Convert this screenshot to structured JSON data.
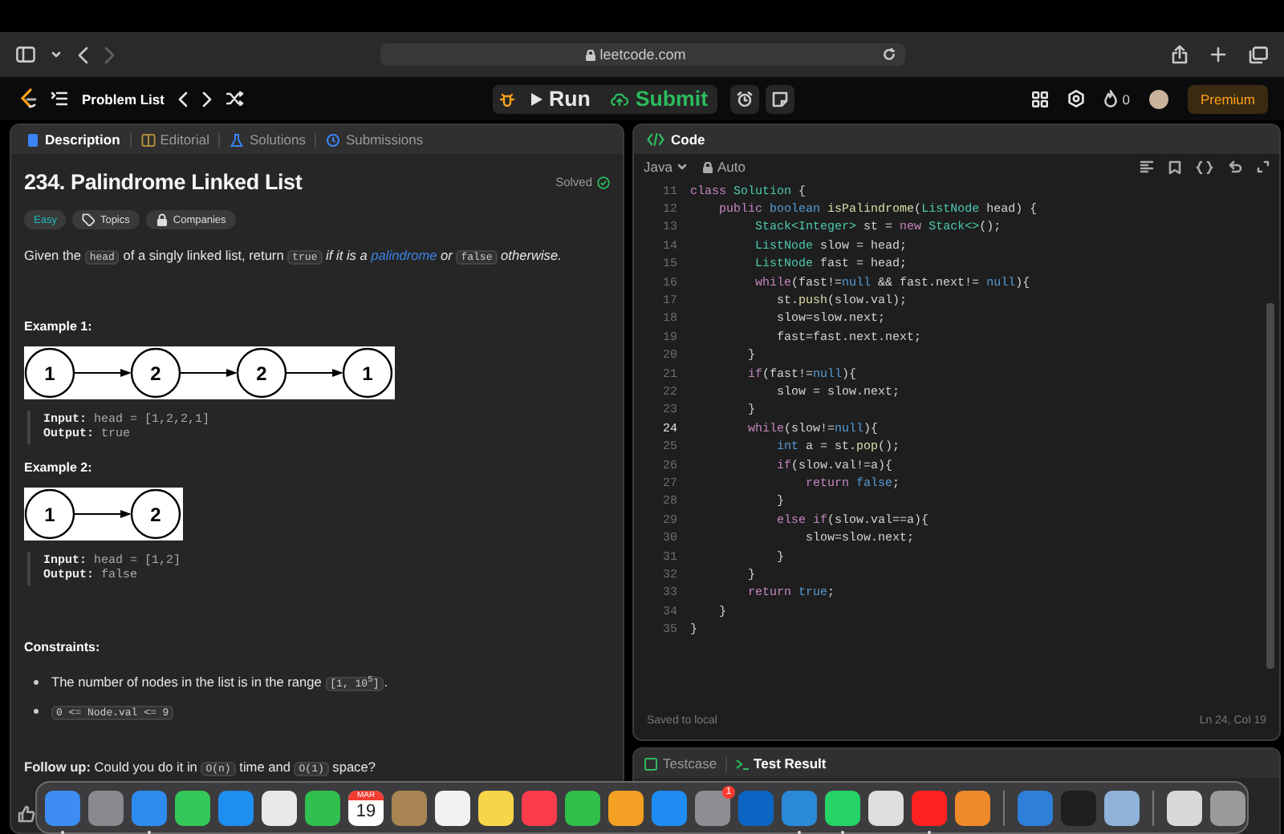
{
  "browser": {
    "url": "leetcode.com",
    "forward_disabled": true
  },
  "nav": {
    "problem_list": "Problem List",
    "run": "Run",
    "submit": "Submit",
    "streak": "0",
    "premium": "Premium"
  },
  "description": {
    "tabs": [
      {
        "label": "Description",
        "selected": true
      },
      {
        "label": "Editorial",
        "selected": false
      },
      {
        "label": "Solutions",
        "selected": false
      },
      {
        "label": "Submissions",
        "selected": false
      }
    ],
    "title": "234. Palindrome Linked List",
    "status": "Solved",
    "difficulty": "Easy",
    "tags": [
      "Topics",
      "Companies"
    ],
    "statement": [
      {
        "kind": "text",
        "text": "Given the "
      },
      {
        "kind": "code",
        "text": "head"
      },
      {
        "kind": "text",
        "text": " of a singly linked list, return "
      },
      {
        "kind": "code",
        "text": "true"
      },
      {
        "kind": "italic",
        "text": " if it is a "
      },
      {
        "kind": "link",
        "text": "palindrome"
      },
      {
        "kind": "italic",
        "text": " or "
      },
      {
        "kind": "code",
        "text": "false"
      },
      {
        "kind": "italic",
        "text": " otherwise."
      }
    ],
    "examples": [
      {
        "title": "Example 1:",
        "nodes": [
          "1",
          "2",
          "2",
          "1"
        ],
        "input": "**Input:** head = [1,2,2,1]",
        "output": "**Output:** true"
      },
      {
        "title": "Example 2:",
        "nodes": [
          "1",
          "2"
        ],
        "input": "**Input:** head = [1,2]",
        "output": "**Output:** false"
      }
    ],
    "constraints_title": "Constraints:",
    "constraints": [
      [
        {
          "kind": "text",
          "text": "The number of nodes in the list is in the range "
        },
        {
          "kind": "code",
          "text": "[1, 10$^{5}$]"
        },
        {
          "kind": "text",
          "text": "."
        }
      ],
      [
        {
          "kind": "code",
          "text": "0 <= Node.val <= 9"
        }
      ]
    ],
    "follow_up": [
      {
        "kind": "bold",
        "text": "Follow up:"
      },
      {
        "kind": "text",
        "text": " Could you do it in "
      },
      {
        "kind": "code",
        "text": "O(n)"
      },
      {
        "kind": "text",
        "text": " time and "
      },
      {
        "kind": "code",
        "text": "O(1)"
      },
      {
        "kind": "text",
        "text": " space?"
      }
    ]
  },
  "code": {
    "title": "Code",
    "language": "Java",
    "mode": "Auto",
    "lines": [
      {
        "number": "11",
        "active": false,
        "segments": [
          {
            "kind": "keyword",
            "text": "class "
          },
          {
            "kind": "type",
            "text": "Solution"
          },
          {
            "kind": "text",
            "text": " {"
          }
        ]
      },
      {
        "number": "12",
        "active": false,
        "segments": [
          {
            "kind": "keyword",
            "text": "    public "
          },
          {
            "kind": "literal",
            "text": "boolean "
          },
          {
            "kind": "function",
            "text": "isPalindrome"
          },
          {
            "kind": "text",
            "text": "("
          },
          {
            "kind": "type",
            "text": "ListNode"
          },
          {
            "kind": "text",
            "text": " head) {"
          }
        ]
      },
      {
        "number": "13",
        "active": false,
        "segments": [
          {
            "kind": "type",
            "text": "         Stack<Integer>"
          },
          {
            "kind": "text",
            "text": " st = "
          },
          {
            "kind": "keyword",
            "text": "new "
          },
          {
            "kind": "type",
            "text": "Stack<>"
          },
          {
            "kind": "text",
            "text": "();"
          }
        ]
      },
      {
        "number": "14",
        "active": false,
        "segments": [
          {
            "kind": "type",
            "text": "         ListNode"
          },
          {
            "kind": "text",
            "text": " slow = head;"
          }
        ]
      },
      {
        "number": "15",
        "active": false,
        "segments": [
          {
            "kind": "type",
            "text": "         ListNode"
          },
          {
            "kind": "text",
            "text": " fast = head;"
          }
        ]
      },
      {
        "number": "16",
        "active": false,
        "segments": [
          {
            "kind": "keyword",
            "text": "         while"
          },
          {
            "kind": "text",
            "text": "(fast!="
          },
          {
            "kind": "literal",
            "text": "null"
          },
          {
            "kind": "text",
            "text": " && fast.next!= "
          },
          {
            "kind": "literal",
            "text": "null"
          },
          {
            "kind": "text",
            "text": "){"
          }
        ]
      },
      {
        "number": "17",
        "active": false,
        "segments": [
          {
            "kind": "text",
            "text": "            st."
          },
          {
            "kind": "function",
            "text": "push"
          },
          {
            "kind": "text",
            "text": "(slow.val);"
          }
        ]
      },
      {
        "number": "18",
        "active": false,
        "segments": [
          {
            "kind": "text",
            "text": "            slow=slow.next;"
          }
        ]
      },
      {
        "number": "19",
        "active": false,
        "segments": [
          {
            "kind": "text",
            "text": "            fast=fast.next.next;"
          }
        ]
      },
      {
        "number": "20",
        "active": false,
        "segments": [
          {
            "kind": "text",
            "text": "        }"
          }
        ]
      },
      {
        "number": "21",
        "active": false,
        "segments": [
          {
            "kind": "keyword",
            "text": "        if"
          },
          {
            "kind": "text",
            "text": "(fast!="
          },
          {
            "kind": "literal",
            "text": "null"
          },
          {
            "kind": "text",
            "text": "){"
          }
        ]
      },
      {
        "number": "22",
        "active": false,
        "segments": [
          {
            "kind": "text",
            "text": "            slow = slow.next;"
          }
        ]
      },
      {
        "number": "23",
        "active": false,
        "segments": [
          {
            "kind": "text",
            "text": "        }"
          }
        ]
      },
      {
        "number": "24",
        "active": true,
        "segments": [
          {
            "kind": "keyword",
            "text": "        while"
          },
          {
            "kind": "text",
            "text": "(slow!="
          },
          {
            "kind": "literal",
            "text": "null"
          },
          {
            "kind": "text",
            "text": "){"
          }
        ]
      },
      {
        "number": "25",
        "active": false,
        "segments": [
          {
            "kind": "literal",
            "text": "            int"
          },
          {
            "kind": "text",
            "text": " a = st."
          },
          {
            "kind": "function",
            "text": "pop"
          },
          {
            "kind": "text",
            "text": "();"
          }
        ]
      },
      {
        "number": "26",
        "active": false,
        "segments": [
          {
            "kind": "keyword",
            "text": "            if"
          },
          {
            "kind": "text",
            "text": "(slow.val!=a){"
          }
        ]
      },
      {
        "number": "27",
        "active": false,
        "segments": [
          {
            "kind": "keyword",
            "text": "                return "
          },
          {
            "kind": "literal",
            "text": "false"
          },
          {
            "kind": "text",
            "text": ";"
          }
        ]
      },
      {
        "number": "28",
        "active": false,
        "segments": [
          {
            "kind": "text",
            "text": "            }"
          }
        ]
      },
      {
        "number": "29",
        "active": false,
        "segments": [
          {
            "kind": "keyword",
            "text": "            else if"
          },
          {
            "kind": "text",
            "text": "(slow.val==a){"
          }
        ]
      },
      {
        "number": "30",
        "active": false,
        "segments": [
          {
            "kind": "text",
            "text": "                slow=slow.next;"
          }
        ]
      },
      {
        "number": "31",
        "active": false,
        "segments": [
          {
            "kind": "text",
            "text": "            }"
          }
        ]
      },
      {
        "number": "32",
        "active": false,
        "segments": [
          {
            "kind": "text",
            "text": "        }"
          }
        ]
      },
      {
        "number": "33",
        "active": false,
        "segments": [
          {
            "kind": "keyword",
            "text": "        return "
          },
          {
            "kind": "literal",
            "text": "true"
          },
          {
            "kind": "text",
            "text": ";"
          }
        ]
      },
      {
        "number": "34",
        "active": false,
        "segments": [
          {
            "kind": "text",
            "text": "    }"
          }
        ]
      },
      {
        "number": "35",
        "active": false,
        "segments": [
          {
            "kind": "text",
            "text": "}"
          }
        ]
      }
    ],
    "save_status": "Saved to local",
    "cursor": "Ln 24, Col 19"
  },
  "test_tabs": [
    {
      "label": "Testcase",
      "selected": false
    },
    {
      "label": "Test Result",
      "selected": true
    }
  ],
  "dock": [
    {
      "kind": "app",
      "color": "#3d8df5",
      "running": true
    },
    {
      "kind": "app",
      "color": "#8a8a8e",
      "running": false
    },
    {
      "kind": "app",
      "color": "#2d8cf0",
      "running": true
    },
    {
      "kind": "app",
      "color": "#34c759",
      "running": false
    },
    {
      "kind": "app",
      "color": "#1e8ef0",
      "running": false
    },
    {
      "kind": "app",
      "color": "#e9e9e9",
      "running": false
    },
    {
      "kind": "app",
      "color": "#30c04f",
      "running": false
    },
    {
      "kind": "calendar",
      "month": "MAR",
      "day": "19",
      "running": false
    },
    {
      "kind": "app",
      "color": "#a88552",
      "running": false
    },
    {
      "kind": "app",
      "color": "#f2f2f2",
      "running": false
    },
    {
      "kind": "app",
      "color": "#f7d548",
      "running": false
    },
    {
      "kind": "app",
      "color": "#fa3c4c",
      "running": false
    },
    {
      "kind": "app",
      "color": "#2fbf4a",
      "running": false
    },
    {
      "kind": "app",
      "color": "#f4a024",
      "running": false
    },
    {
      "kind": "app",
      "color": "#1f8cf5",
      "running": false
    },
    {
      "kind": "app",
      "color": "#8e8e93",
      "running": false,
      "badge": "1"
    },
    {
      "kind": "app",
      "color": "#0a66c2",
      "running": false
    },
    {
      "kind": "app",
      "color": "#2a8ad8",
      "running": true
    },
    {
      "kind": "app",
      "color": "#25d366",
      "running": true
    },
    {
      "kind": "app",
      "color": "#dedede",
      "running": false
    },
    {
      "kind": "app",
      "color": "#ff2020",
      "running": true
    },
    {
      "kind": "app",
      "color": "#ee8a2a",
      "running": false
    },
    {
      "kind": "separator"
    },
    {
      "kind": "app",
      "color": "#2f7fd8",
      "running": false
    },
    {
      "kind": "app",
      "color": "#1e1e1e",
      "running": false
    },
    {
      "kind": "app",
      "color": "#8fb3d9",
      "running": false
    },
    {
      "kind": "separator"
    },
    {
      "kind": "app",
      "color": "#d8d8d8",
      "running": false
    },
    {
      "kind": "app",
      "color": "#9a9a9a",
      "running": false
    }
  ]
}
